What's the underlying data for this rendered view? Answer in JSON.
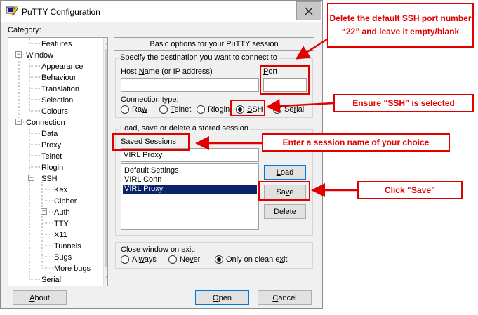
{
  "window": {
    "title": "PuTTY Configuration",
    "category_label": "Category:"
  },
  "tree": {
    "items": [
      {
        "label": "Features"
      },
      {
        "label": "Window"
      },
      {
        "label": "Appearance"
      },
      {
        "label": "Behaviour"
      },
      {
        "label": "Translation"
      },
      {
        "label": "Selection"
      },
      {
        "label": "Colours"
      },
      {
        "label": "Connection"
      },
      {
        "label": "Data"
      },
      {
        "label": "Proxy"
      },
      {
        "label": "Telnet"
      },
      {
        "label": "Rlogin"
      },
      {
        "label": "SSH"
      },
      {
        "label": "Kex"
      },
      {
        "label": "Cipher"
      },
      {
        "label": "Auth"
      },
      {
        "label": "TTY"
      },
      {
        "label": "X11"
      },
      {
        "label": "Tunnels"
      },
      {
        "label": "Bugs"
      },
      {
        "label": "More bugs"
      },
      {
        "label": "Serial"
      }
    ]
  },
  "session": {
    "header": "Basic options for your PuTTY session",
    "dest_legend": "Specify the destination you want to connect to",
    "host_label": "Host Name (or IP address)",
    "host_value": "",
    "port_label": "Port",
    "port_value": "",
    "conn_type_label": "Connection type:",
    "conn_types": [
      "Raw",
      "Telnet",
      "Rlogin",
      "SSH",
      "Serial"
    ],
    "selected_conn_type": "SSH",
    "load_legend": "Load, save or delete a stored session",
    "saved_sessions_label": "Saved Sessions",
    "saved_session_value": "VIRL Proxy",
    "sessions": [
      "Default Settings",
      "VIRL Conn",
      "VIRL Proxy"
    ],
    "selected_session": "VIRL Proxy",
    "load_btn": "Load",
    "save_btn": "Save",
    "delete_btn": "Delete",
    "close_legend": "Close window on exit:",
    "close_options": [
      "Always",
      "Never",
      "Only on clean exit"
    ],
    "selected_close": "Only on clean exit"
  },
  "footer": {
    "about_btn": "About",
    "open_btn": "Open",
    "cancel_btn": "Cancel"
  },
  "annotations": {
    "port_note": "Delete the default SSH port number “22” and leave it empty/blank",
    "ssh_note": "Ensure “SSH” is selected",
    "session_note": "Enter a session name of your choice",
    "save_note": "Click “Save”",
    "color": "#e00000"
  },
  "icons": {
    "app": "putty-icon",
    "close": "close-icon"
  }
}
